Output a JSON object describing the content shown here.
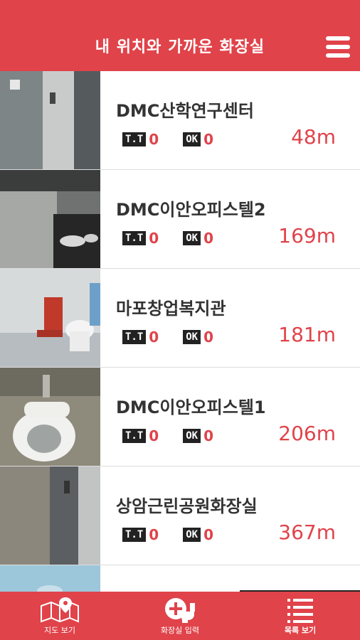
{
  "header": {
    "title": "내 위치와 가까운 화장실",
    "menu_icon": "hamburger-menu-icon"
  },
  "badges": {
    "tt": "T.T",
    "ok": "OK"
  },
  "colors": {
    "brand": "#e0434a",
    "badge_bg": "#222222"
  },
  "items": [
    {
      "name": "DMC산학연구센터",
      "tt_count": "0",
      "ok_count": "0",
      "distance": "48m"
    },
    {
      "name": "DMC이안오피스텔2",
      "tt_count": "0",
      "ok_count": "0",
      "distance": "169m"
    },
    {
      "name": "마포창업복지관",
      "tt_count": "0",
      "ok_count": "0",
      "distance": "181m"
    },
    {
      "name": "DMC이안오피스텔1",
      "tt_count": "0",
      "ok_count": "0",
      "distance": "206m"
    },
    {
      "name": "상암근린공원화장실",
      "tt_count": "0",
      "ok_count": "0",
      "distance": "367m"
    }
  ],
  "tabs": [
    {
      "label": "지도 보기",
      "icon": "map-icon"
    },
    {
      "label": "화장실 입력",
      "icon": "add-toilet-icon"
    },
    {
      "label": "목록 보기",
      "icon": "list-icon",
      "active": true
    }
  ]
}
